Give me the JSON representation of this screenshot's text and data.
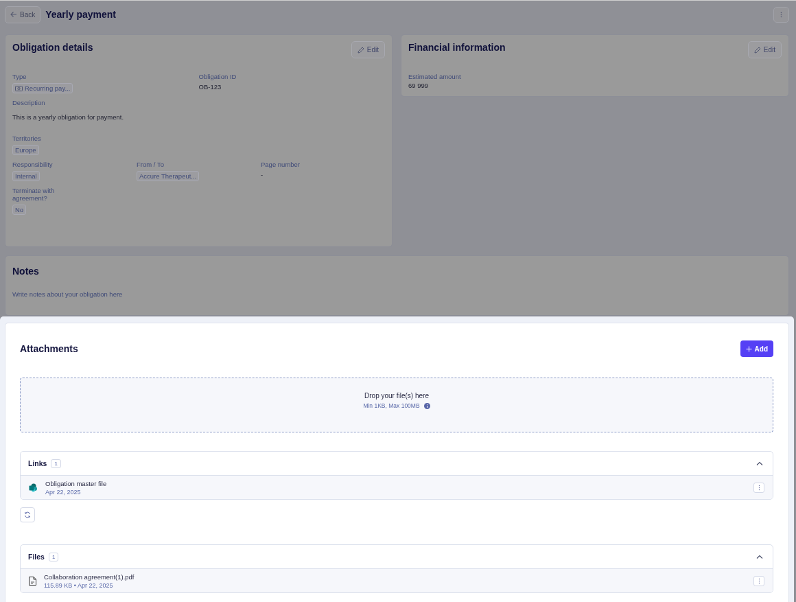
{
  "header": {
    "back_button": "Back",
    "title": "Yearly payment"
  },
  "obligation_details": {
    "title": "Obligation details",
    "edit_button": "Edit",
    "rows": [
      {
        "fields": [
          {
            "label": "Type",
            "value": "Recurring pay...",
            "kind": "icon_tag"
          },
          {
            "label": "Obligation ID",
            "value": "OB-123",
            "kind": "text"
          }
        ]
      },
      {
        "fields": [
          {
            "label": "Description",
            "value": "This is a yearly obligation for payment.",
            "kind": "paragraph"
          }
        ]
      },
      {
        "fields": [
          {
            "label": "Territories",
            "value": "Europe",
            "kind": "tag"
          }
        ]
      },
      {
        "fields": [
          {
            "label": "Responsibility",
            "value": "Internal",
            "kind": "tag"
          },
          {
            "label": "From / To",
            "value": "Accure Therapeut...",
            "kind": "tag"
          },
          {
            "label": "Page number",
            "value": "-",
            "kind": "text"
          }
        ]
      },
      {
        "fields": [
          {
            "label": "Terminate with agreement?",
            "value": "No",
            "kind": "tag"
          }
        ]
      }
    ]
  },
  "financial_information": {
    "title": "Financial information",
    "edit_button": "Edit",
    "fields": [
      {
        "label": "Estimated amount",
        "value": "69 999"
      }
    ]
  },
  "notes": {
    "title": "Notes",
    "placeholder": "Write notes about your obligation here"
  },
  "attachments": {
    "title": "Attachments",
    "add_button": "Add",
    "dropzone": {
      "text": "Drop your file(s) here",
      "hint": "Min 1KB, Max 100MB"
    },
    "sections": [
      {
        "kind": "links",
        "title": "Links",
        "count": "1",
        "expanded": true,
        "items": [
          {
            "name": "Obligation master file",
            "meta": "Apr 22, 2025"
          }
        ]
      },
      {
        "kind": "files",
        "title": "Files",
        "count": "1",
        "expanded": true,
        "items": [
          {
            "name": "Collaboration agreement(1).pdf",
            "meta": "115.89 KB • Apr 22, 2025"
          }
        ]
      }
    ]
  }
}
